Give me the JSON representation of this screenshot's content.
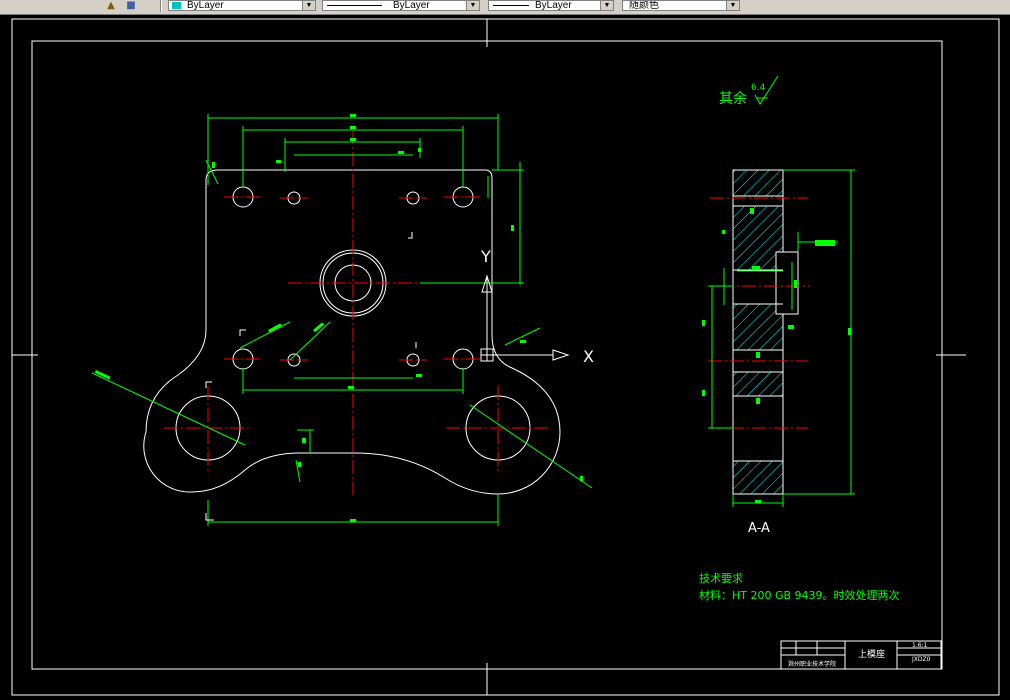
{
  "toolbar": {
    "icons": [
      "layer-manager-icon",
      "layer-previous-icon"
    ],
    "color_combo": {
      "value": "ByLayer",
      "swatch_color": "#00c0c0"
    },
    "linetype_combo": {
      "value": "ByLayer"
    },
    "lineweight_combo": {
      "value": "ByLayer"
    },
    "plotstyle_combo": {
      "value": "随颜色"
    }
  },
  "drawing": {
    "surface_finish": {
      "label": "其余",
      "value": "6.4"
    },
    "section_label": "A-A",
    "ucs": {
      "x": "X",
      "y": "Y"
    },
    "tech_title": "技术要求",
    "tech_text": "材料：HT 200 GB 9439。时效处理两次",
    "title_block": {
      "part_name": "上模座",
      "scale": "1.6:1",
      "drawing_no": "JXDZ0",
      "org": "滁州职业技术学院"
    },
    "colors": {
      "outline": "#ffffff",
      "dimension": "#00ff00",
      "centerline": "#ff0000",
      "hatch": "#00ffff"
    }
  }
}
